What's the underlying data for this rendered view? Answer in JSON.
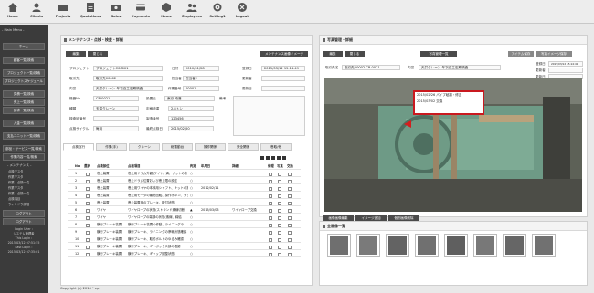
{
  "nav": [
    {
      "label": "Home",
      "icon": "home-icon"
    },
    {
      "label": "Clients",
      "icon": "clients-icon"
    },
    {
      "label": "Projects",
      "icon": "projects-icon"
    },
    {
      "label": "Quotations",
      "icon": "quotations-icon"
    },
    {
      "label": "Sales",
      "icon": "sales-icon"
    },
    {
      "label": "Payments",
      "icon": "payments-icon"
    },
    {
      "label": "Items",
      "icon": "items-icon"
    },
    {
      "label": "Employees",
      "icon": "employees-icon"
    },
    {
      "label": "Setting1",
      "icon": "gear-icon"
    },
    {
      "label": "Logout",
      "icon": "close-icon"
    }
  ],
  "sidebar": {
    "heading": "- Main Menu -",
    "buttons": [
      "ホーム",
      "顧客一覧/検索",
      "プロジェクト一覧/検索",
      "プロジェクトスケジュール",
      "見積一覧/検索",
      "売上一覧/検索",
      "請求一覧/検索",
      "入金一覧/検索",
      "支払ユニット一覧/検索",
      "部品・サービス一覧/検索",
      "作業内容一覧/検索"
    ],
    "subheading": "- メンテナンス -",
    "subitems": [
      "点検マスタ",
      "作業マスタ",
      "作業・点検一覧",
      "作業マスタ",
      "作業・点検一覧",
      "点検項目",
      "ウィンドウ詳細"
    ],
    "extra_buttons": [
      "ログアウト",
      "ログアウト"
    ],
    "info": [
      "Login User :",
      "システム管理者",
      "This Login :",
      "2015/03/12 07:51:55",
      "Last Login :",
      "2015/03/12 07:35:01"
    ]
  },
  "footer": "Copyright (c) 2014 * ep",
  "left_panel": {
    "title": "メンテナンス・点検・検査・詳細",
    "btn_edit": "編集",
    "btn_close": "閉じる",
    "btn_image": "メンテナンス画像イメージ",
    "fields": {
      "project_label": "プロジェクト",
      "project_value": "プロジェクトC00001",
      "date_label": "日付",
      "date_value": "2010/01/28",
      "regdate_label": "登録日",
      "regdate_value": "2015/03/12 15:14:49",
      "client_label": "取引先",
      "client_value": "取引先00002",
      "manager_label": "担当者",
      "manager_value": "担当者2",
      "update_label": "更新者",
      "update_value": "",
      "content_label": "内容",
      "content_value": "天井クレーン 年次自主定期検査",
      "assoc_label": "作業番号",
      "assoc_value": "00001",
      "updtime_label": "更新日",
      "updtime_value": "",
      "machine_label": "機器No",
      "machine_value": "CR-0021",
      "name_label": "設置先",
      "name_value": "東京 南港",
      "type_label": "種類",
      "type_value": "天井クレーン",
      "cap_label": "定格荷重",
      "cap_value": "2.8トン",
      "insp_label": "検査証番号",
      "insp_value": "",
      "mfr_label": "製造番号",
      "mfr_value": "123456",
      "cycle_label": "点検サイクル",
      "cycle_value": "毎月",
      "next_label": "最終点検日",
      "next_value": "2015/02/20",
      "note_label": "備考"
    },
    "tabs": [
      "点検実行",
      "作業(手)",
      "クレーン",
      "総電動台",
      "操作関係",
      "安全関係",
      "巻取/他"
    ],
    "table_headers": [
      "No",
      "選択",
      "点検部位",
      "点検項目",
      "判定",
      "年月日",
      "詳細",
      "修理",
      "写真",
      "交換"
    ],
    "rows": [
      {
        "no": "1",
        "part": "巻上装置",
        "item": "巻上用ドラム外観(ワイヤ、溝、ナットの折",
        "result": "○",
        "date": "",
        "detail": ""
      },
      {
        "no": "2",
        "part": "巻上装置",
        "item": "巻上ドラム位置および巻上限の設定",
        "result": "○",
        "date": "",
        "detail": ""
      },
      {
        "no": "3",
        "part": "巻上装置",
        "item": "巻上用ワイヤの本体用シャフト、ナットの折",
        "result": "○",
        "date": "2012/02/11",
        "detail": ""
      },
      {
        "no": "4",
        "part": "巻上装置",
        "item": "巻上用モータの最終回転、操作ボタン、ナッ",
        "result": "○",
        "date": "",
        "detail": ""
      },
      {
        "no": "5",
        "part": "巻上装置",
        "item": "巻上装置用のブレーキ、取付状態",
        "result": "○",
        "date": "",
        "detail": ""
      },
      {
        "no": "6",
        "part": "ワイヤ",
        "item": "ワイヤロープの状態(ストランド素線切断",
        "result": "▲",
        "date": "2015/03/03",
        "detail": "ワイヤロープ交換"
      },
      {
        "no": "7",
        "part": "ワイヤ",
        "item": "ワイヤロープの端部の状態(素線、締結",
        "result": "○",
        "date": "",
        "detail": ""
      },
      {
        "no": "8",
        "part": "横行ブレーキ装置",
        "item": "横行ブレーキ装置の作動、ライニングの",
        "result": "○",
        "date": "",
        "detail": ""
      },
      {
        "no": "9",
        "part": "横行ブレーキ装置",
        "item": "横行ブレーキ、ライニングの摩耗状態確認",
        "result": "○",
        "date": "",
        "detail": ""
      },
      {
        "no": "10",
        "part": "横行ブレーキ装置",
        "item": "横行ブレーキ、取付ボルトのゆるみ確認",
        "result": "○",
        "date": "",
        "detail": ""
      },
      {
        "no": "11",
        "part": "横行ブレーキ装置",
        "item": "横行ブレーキ、ギヤボックス部の確認",
        "result": "○",
        "date": "",
        "detail": ""
      },
      {
        "no": "12",
        "part": "横行ブレーキ装置",
        "item": "横行ブレーキ、ギャップ調整状態",
        "result": "○",
        "date": "",
        "detail": ""
      }
    ]
  },
  "right_panel": {
    "title": "写真管理・詳細",
    "btn_edit": "編集",
    "btn_close": "閉じる",
    "btn_list": "写真管理一覧",
    "btn_save": "アイテム保存",
    "btn_upload": "写真イメージ保存",
    "client_label": "取引先名",
    "client_value": "取引先00002 CR-0021",
    "content_label": "内容",
    "content_value": "天井クレーン 年次自主定期検査",
    "regdate_label": "登録日",
    "regdate_value": "2015/03/12 15:14:49",
    "update_label": "更新者",
    "update_value": "",
    "updtime_label": "更新日",
    "updtime_value": "",
    "note_lines": [
      "2015/02/26 パイプ破損・修正",
      "2015/03/02 交換"
    ],
    "list_title": "全画像一覧",
    "list_buttons": [
      "画像画像編集",
      "イメージ追加",
      "個別画像削除"
    ]
  }
}
